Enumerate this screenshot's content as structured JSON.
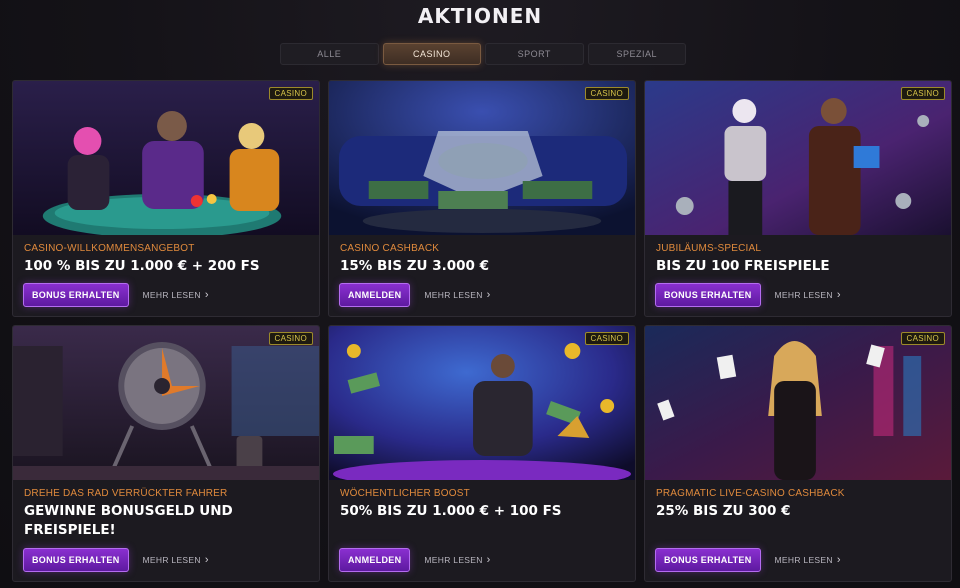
{
  "header": {
    "title": "AKTIONEN"
  },
  "tabs": [
    {
      "label": "ALLE",
      "active": false
    },
    {
      "label": "CASINO",
      "active": true
    },
    {
      "label": "SPORT",
      "active": false
    },
    {
      "label": "SPEZIAL",
      "active": false
    }
  ],
  "cards": [
    {
      "badge": "CASINO",
      "subtitle": "CASINO-WILLKOMMENSANGEBOT",
      "title": "100 % BIS ZU 1.000 € + 200 FS",
      "button": "BONUS ERHALTEN",
      "more": "MEHR LESEN"
    },
    {
      "badge": "CASINO",
      "subtitle": "CASINO CASHBACK",
      "title": "15% BIS ZU 3.000 €",
      "button": "ANMELDEN",
      "more": "MEHR LESEN"
    },
    {
      "badge": "CASINO",
      "subtitle": "JUBILÄUMS-SPECIAL",
      "title": "BIS ZU 100 FREISPIELE",
      "button": "BONUS ERHALTEN",
      "more": "MEHR LESEN"
    },
    {
      "badge": "CASINO",
      "subtitle": "DREHE DAS RAD VERRÜCKTER FAHRER",
      "title": "GEWINNE BONUSGELD UND FREISPIELE!",
      "button": "BONUS ERHALTEN",
      "more": "MEHR LESEN"
    },
    {
      "badge": "CASINO",
      "subtitle": "WÖCHENTLICHER BOOST",
      "title": "50% BIS ZU 1.000 € + 100 FS",
      "button": "ANMELDEN",
      "more": "MEHR LESEN"
    },
    {
      "badge": "CASINO",
      "subtitle": "PRAGMATIC LIVE-CASINO CASHBACK",
      "title": "25% BIS ZU 300 €",
      "button": "BONUS ERHALTEN",
      "more": "MEHR LESEN"
    }
  ],
  "colors": {
    "accent_button": "#7a26c0",
    "subtitle_orange": "#e08a3c",
    "badge_gold": "#d9c64a",
    "active_tab": "#4a3628"
  }
}
